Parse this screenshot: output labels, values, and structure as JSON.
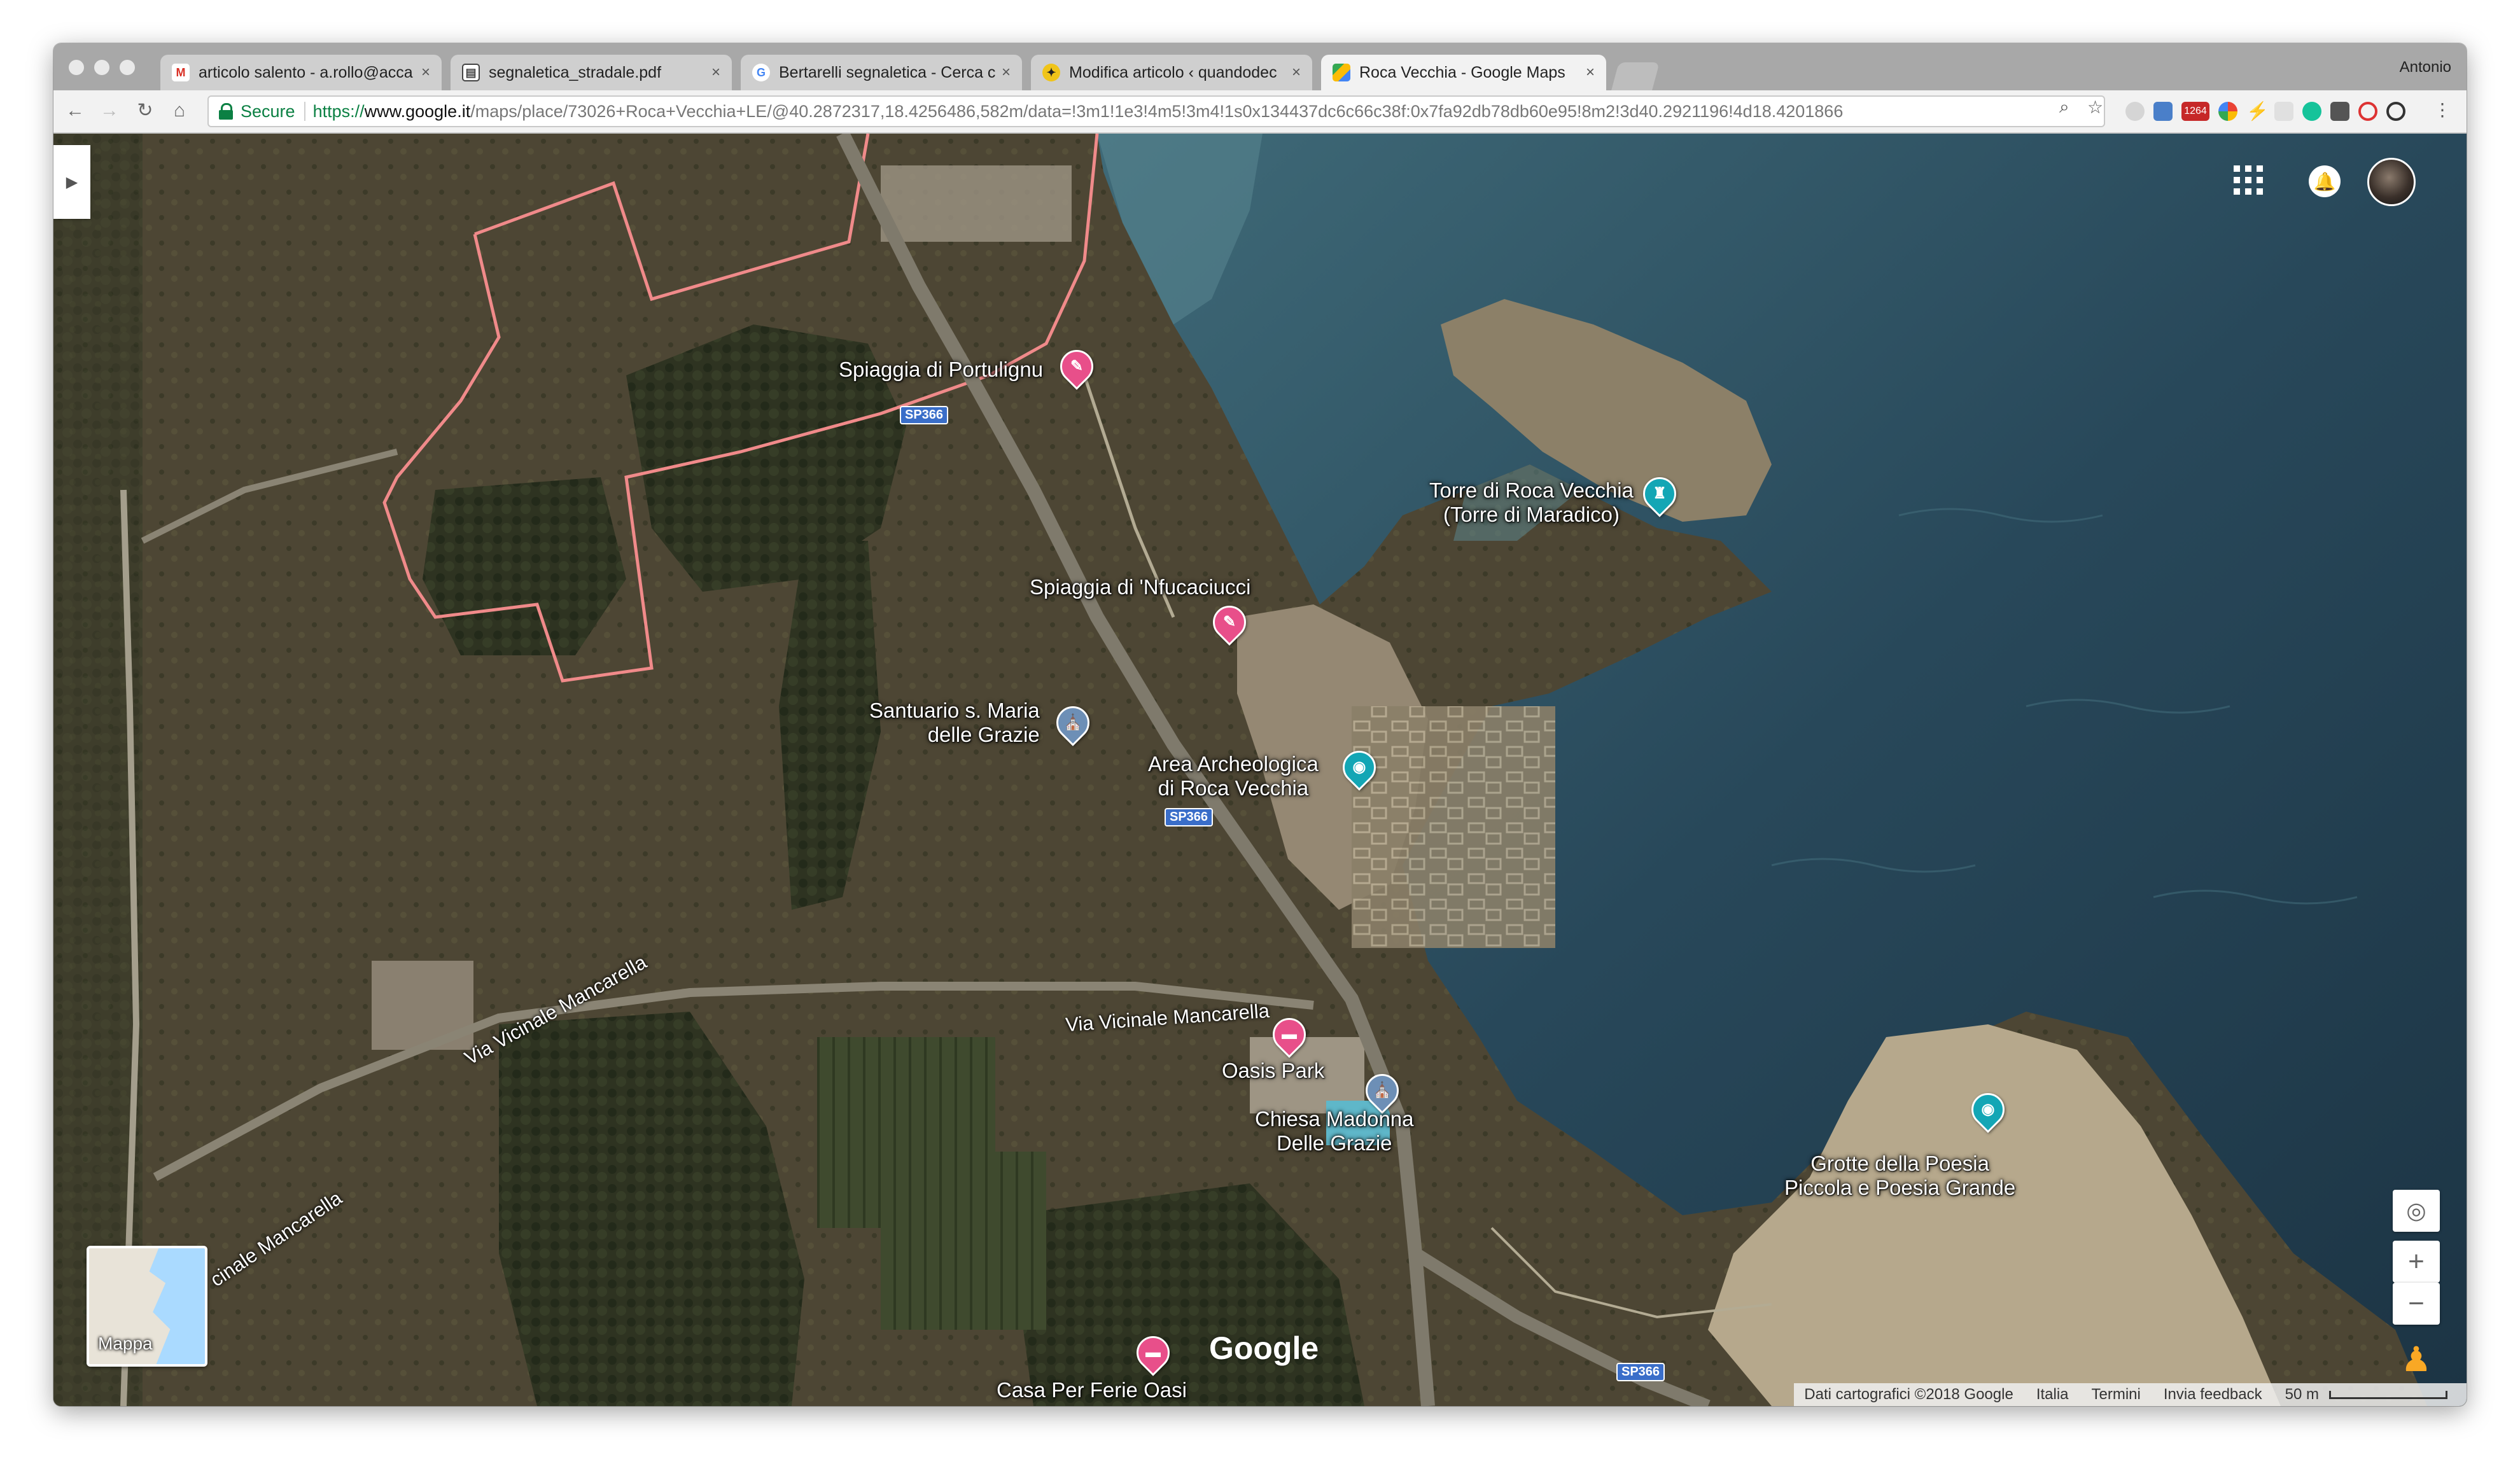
{
  "browser": {
    "profile_name": "Antonio",
    "tabs": [
      {
        "title": "articolo salento - a.rollo@acca",
        "icon": "gmail-icon",
        "active": false
      },
      {
        "title": "segnaletica_stradale.pdf",
        "icon": "pdf-icon",
        "active": false
      },
      {
        "title": "Bertarelli segnaletica - Cerca c",
        "icon": "google-icon",
        "active": false
      },
      {
        "title": "Modifica articolo ‹ quandodec",
        "icon": "wordpress-icon",
        "active": false
      },
      {
        "title": "Roca Vecchia - Google Maps",
        "icon": "maps-icon",
        "active": true
      }
    ],
    "close_glyph": "×",
    "omnibox": {
      "secure_label": "Secure",
      "url_scheme": "https://",
      "url_host": "www.google.it",
      "url_path": "/maps/place/73026+Roca+Vecchia+LE/@40.2872317,18.4256486,582m/data=!3m1!1e3!4m5!3m4!1s0x134437dc6c66c38f:0x7fa92db78db60e95!8m2!3d40.2921196!4d18.4201866"
    },
    "extension_badge": "1264"
  },
  "map": {
    "view": "satellite",
    "places": {
      "spiaggia_portulignu": "Spiaggia di Portulignu",
      "torre_line1": "Torre di Roca Vecchia",
      "torre_line2": "(Torre di Maradico)",
      "spiaggia_nfucaciucci": "Spiaggia di 'Nfucaciucci",
      "santuario_line1": "Santuario s. Maria",
      "santuario_line2": "delle Grazie",
      "area_line1": "Area Archeologica",
      "area_line2": "di Roca Vecchia",
      "oasis_park": "Oasis Park",
      "chiesa_line1": "Chiesa Madonna",
      "chiesa_line2": "Delle Grazie",
      "grotte_line1": "Grotte della Poesia",
      "grotte_line2": "Piccola e Poesia Grande",
      "casa_per_ferie": "Casa Per Ferie Oasi"
    },
    "roads": {
      "via_vicinale_1": "Via Vicinale Mancarella",
      "via_vicinale_2": "Via Vicinale Mancarella",
      "via_vicinale_3": "cinale Mancarella",
      "sp366": "SP366"
    },
    "minimap_label": "Mappa",
    "logo": "Google",
    "footer": {
      "data_credit": "Dati cartografici ©2018 Google",
      "country": "Italia",
      "terms": "Termini",
      "feedback": "Invia feedback",
      "scale": "50 m"
    },
    "controls": {
      "zoom_in": "+",
      "zoom_out": "−"
    },
    "colors": {
      "sea_deep": "#1f3a4a",
      "sea_shallow": "#3f6a78",
      "land": "#4a4533",
      "pin_pink": "#e84f8a",
      "pin_teal": "#13a6b5",
      "boundary": "#f08a8a"
    }
  }
}
